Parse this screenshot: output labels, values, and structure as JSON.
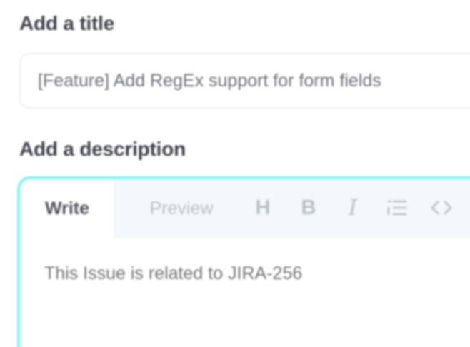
{
  "title_section": {
    "label": "Add a title",
    "input_value": "[Feature] Add RegEx support for form fields"
  },
  "description_section": {
    "label": "Add a description",
    "tabs": [
      {
        "label": "Write",
        "active": true
      },
      {
        "label": "Preview",
        "active": false
      }
    ],
    "toolbar": [
      {
        "icon": "heading-icon",
        "glyph": "H"
      },
      {
        "icon": "bold-icon",
        "glyph": "B"
      },
      {
        "icon": "italic-icon",
        "glyph": "I"
      },
      {
        "icon": "list-icon"
      },
      {
        "icon": "code-icon"
      }
    ],
    "placeholder": "This Issue is related to JIRA-256"
  },
  "colors": {
    "focus_border": "#7ff3f3",
    "toolbar_bg": "#f4f8fc"
  }
}
